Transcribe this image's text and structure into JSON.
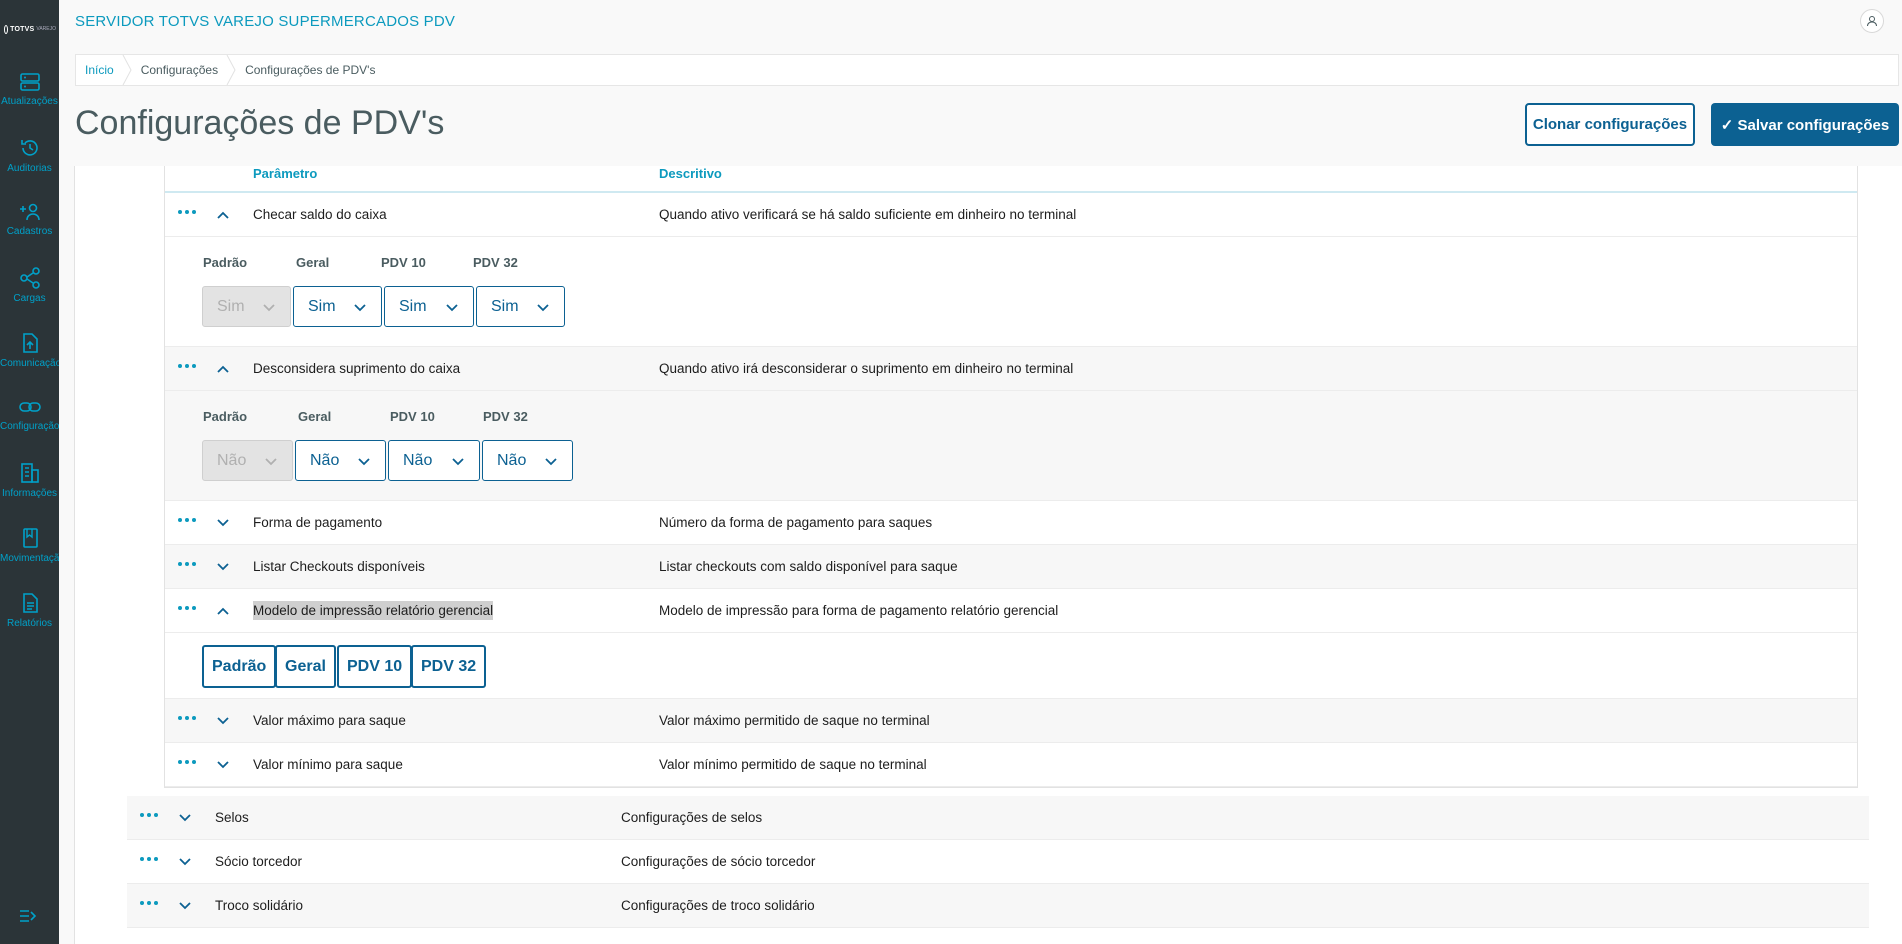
{
  "app": {
    "title": "SERVIDOR TOTVS VAREJO SUPERMERCADOS PDV"
  },
  "logo": {
    "brand": "TOTVS",
    "sub": "VAREJO"
  },
  "sidebar": {
    "items": [
      {
        "label": "Atualizações",
        "icon": "server-icon"
      },
      {
        "label": "Auditorias",
        "icon": "history-icon"
      },
      {
        "label": "Cadastros",
        "icon": "add-user-icon"
      },
      {
        "label": "Cargas",
        "icon": "share-icon"
      },
      {
        "label": "Comunicação",
        "icon": "document-upload-icon"
      },
      {
        "label": "Configuração",
        "icon": "link-icon"
      },
      {
        "label": "Informações",
        "icon": "building-icon"
      },
      {
        "label": "Movimentação",
        "icon": "book-icon"
      },
      {
        "label": "Relatórios",
        "icon": "report-icon"
      }
    ]
  },
  "breadcrumb": [
    "Início",
    "Configurações",
    "Configurações de PDV's"
  ],
  "page": {
    "title": "Configurações de PDV's",
    "clone_label": "Clonar configurações",
    "save_label": "✓ Salvar configurações"
  },
  "table": {
    "columns": {
      "param": "Parâmetro",
      "desc": "Descritivo"
    },
    "rows": [
      {
        "param": "Checar saldo do caixa",
        "desc": "Quando ativo verificará se há saldo suficiente em dinheiro no terminal",
        "expanded": true
      },
      {
        "param": "Desconsidera suprimento do caixa",
        "desc": "Quando ativo irá desconsiderar o suprimento em dinheiro no terminal",
        "expanded": true
      },
      {
        "param": "Forma de pagamento",
        "desc": "Número da forma de pagamento para saques",
        "expanded": false
      },
      {
        "param": "Listar Checkouts disponíveis",
        "desc": "Listar checkouts com saldo disponível para saque",
        "expanded": false
      },
      {
        "param": "Modelo de impressão relatório gerencial",
        "desc": "Modelo de impressão para forma de pagamento relatório gerencial",
        "expanded": true
      },
      {
        "param": "Valor máximo para saque",
        "desc": "Valor máximo permitido de saque no terminal",
        "expanded": false
      },
      {
        "param": "Valor mínimo para saque",
        "desc": "Valor mínimo permitido de saque no terminal",
        "expanded": false
      }
    ],
    "detail1": {
      "labels": [
        "Padrão",
        "Geral",
        "PDV 10",
        "PDV 32"
      ],
      "values": [
        "Sim",
        "Sim",
        "Sim",
        "Sim"
      ]
    },
    "detail2": {
      "labels": [
        "Padrão",
        "Geral",
        "PDV 10",
        "PDV 32"
      ],
      "values": [
        "Não",
        "Não",
        "Não",
        "Não"
      ]
    },
    "detail3": {
      "chips": [
        "Padrão",
        "Geral",
        "PDV 10",
        "PDV 32"
      ]
    }
  },
  "groups": [
    {
      "param": "Selos",
      "desc": "Configurações de selos"
    },
    {
      "param": "Sócio torcedor",
      "desc": "Configurações de sócio torcedor"
    },
    {
      "param": "Troco solidário",
      "desc": "Configurações de troco solidário"
    }
  ],
  "colors": {
    "accent": "#0c9abe",
    "primary": "#0c6192",
    "sidebar": "#2b3438"
  }
}
